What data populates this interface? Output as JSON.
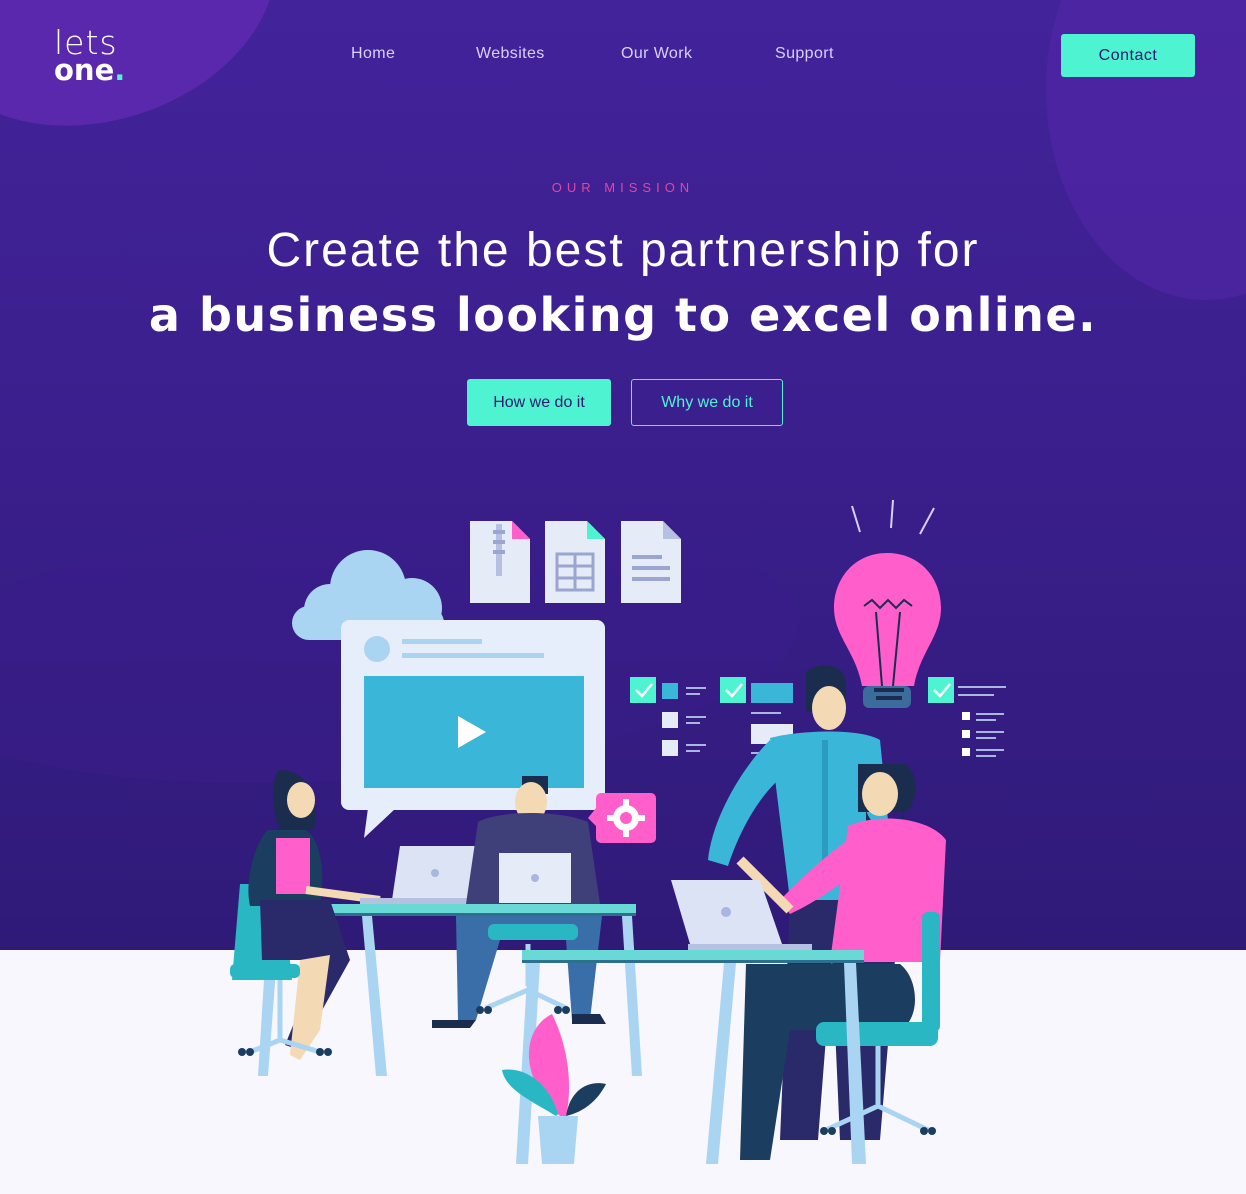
{
  "brand": {
    "line1": "lets",
    "line2": "one",
    "dot": "."
  },
  "nav": {
    "items": [
      {
        "label": "Home"
      },
      {
        "label": "Websites"
      },
      {
        "label": "Our Work"
      },
      {
        "label": "Support"
      }
    ],
    "contact_label": "Contact"
  },
  "hero": {
    "eyebrow": "OUR MISSION",
    "headline_line1": "Create the best partnership for",
    "headline_line2": "a business looking to excel online.",
    "primary_cta": "How we do it",
    "secondary_cta": "Why we do it"
  },
  "illustration": {
    "icons": [
      "cloud-icon",
      "zip-file-icon",
      "spreadsheet-file-icon",
      "document-file-icon",
      "video-play-icon",
      "gear-icon",
      "lightbulb-icon",
      "checklist-icon",
      "laptop-icon",
      "plant-icon"
    ]
  },
  "colors": {
    "hero_background": "#3b1f8d",
    "accent_teal": "#4ef3d2",
    "accent_pink": "#e0479f",
    "page_background": "#f8f7fd"
  }
}
